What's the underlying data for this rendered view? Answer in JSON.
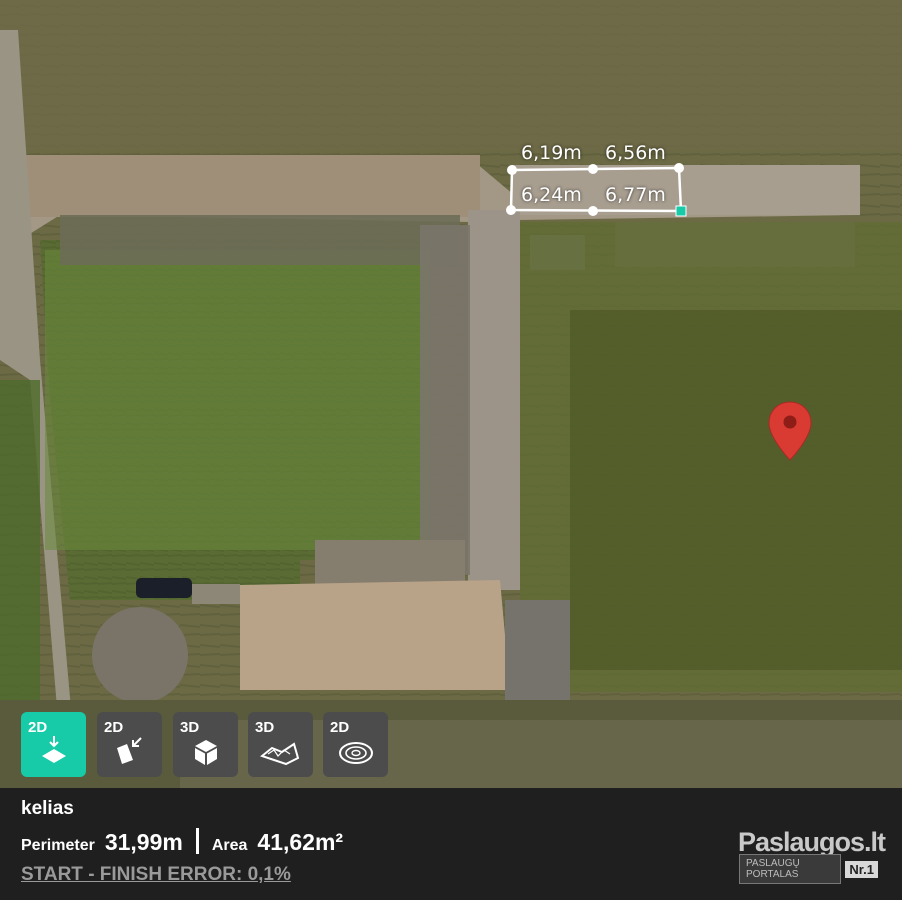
{
  "map": {
    "measure_labels": [
      "6,19m",
      "6,56m",
      "6,24m",
      "6,77m"
    ],
    "marker_icon": "map-pin-icon",
    "accent": "#18cba8",
    "marker_color": "#d93a32"
  },
  "toolbar": {
    "buttons": [
      {
        "label": "2D",
        "icon": "2d-point-icon",
        "active": true
      },
      {
        "label": "2D",
        "icon": "2d-shape-icon",
        "active": false
      },
      {
        "label": "3D",
        "icon": "3d-cube-icon",
        "active": false
      },
      {
        "label": "3D",
        "icon": "3d-terrain-icon",
        "active": false
      },
      {
        "label": "2D",
        "icon": "2d-contour-icon",
        "active": false
      }
    ]
  },
  "panel": {
    "name": "kelias",
    "perimeter_label": "Perimeter",
    "perimeter_value": "31,99m",
    "area_label": "Area",
    "area_value": "41,62m²",
    "error_text": "START - FINISH ERROR: 0,1%"
  },
  "logo": {
    "title": "Paslaugos.lt",
    "subtitle": "PASLAUGŲ PORTALAS",
    "badge": "Nr.1"
  }
}
